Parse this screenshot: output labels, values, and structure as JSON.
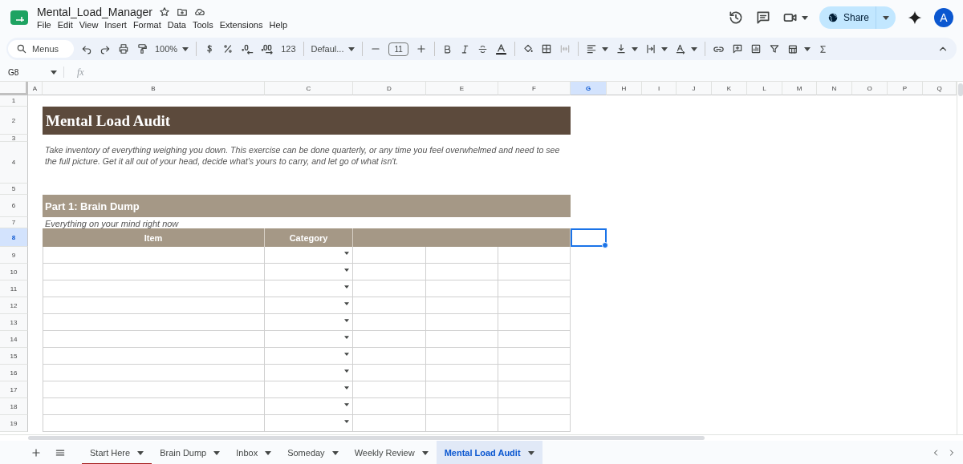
{
  "app": {
    "doc_title": "Mental_Load_Manager",
    "menu": [
      "File",
      "Edit",
      "View",
      "Insert",
      "Format",
      "Data",
      "Tools",
      "Extensions",
      "Help"
    ],
    "share_label": "Share",
    "avatar_letter": "A"
  },
  "toolbar": {
    "search_placeholder": "Menus",
    "zoom": "100%",
    "number_format": "123",
    "font": "Defaul...",
    "font_size": "11"
  },
  "formula_bar": {
    "name_box": "G8",
    "fx": "fx"
  },
  "columns": [
    {
      "label": "A",
      "selected": false
    },
    {
      "label": "B",
      "selected": false
    },
    {
      "label": "C",
      "selected": false
    },
    {
      "label": "D",
      "selected": false
    },
    {
      "label": "E",
      "selected": false
    },
    {
      "label": "F",
      "selected": false
    },
    {
      "label": "G",
      "selected": true
    },
    {
      "label": "H",
      "selected": false
    },
    {
      "label": "I",
      "selected": false
    },
    {
      "label": "J",
      "selected": false
    },
    {
      "label": "K",
      "selected": false
    },
    {
      "label": "L",
      "selected": false
    },
    {
      "label": "M",
      "selected": false
    },
    {
      "label": "N",
      "selected": false
    },
    {
      "label": "O",
      "selected": false
    },
    {
      "label": "P",
      "selected": false
    },
    {
      "label": "Q",
      "selected": false
    }
  ],
  "rows": [
    {
      "label": "1",
      "selected": false
    },
    {
      "label": "2",
      "selected": false
    },
    {
      "label": "3",
      "selected": false
    },
    {
      "label": "4",
      "selected": false
    },
    {
      "label": "5",
      "selected": false
    },
    {
      "label": "6",
      "selected": false
    },
    {
      "label": "7",
      "selected": false
    },
    {
      "label": "8",
      "selected": true
    },
    {
      "label": "9",
      "selected": false
    },
    {
      "label": "10",
      "selected": false
    },
    {
      "label": "11",
      "selected": false
    },
    {
      "label": "12",
      "selected": false
    },
    {
      "label": "13",
      "selected": false
    },
    {
      "label": "14",
      "selected": false
    },
    {
      "label": "15",
      "selected": false
    },
    {
      "label": "16",
      "selected": false
    },
    {
      "label": "17",
      "selected": false
    },
    {
      "label": "18",
      "selected": false
    },
    {
      "label": "19",
      "selected": false
    }
  ],
  "sheet": {
    "title": "Mental Load Audit",
    "intro": "Take inventory of everything weighing you down. This exercise can be done quarterly, or any time you feel overwhelmed and need to see the full picture. Get it all out of your head, decide what's yours to carry, and let go of what isn't.",
    "section": "Part 1: Brain Dump",
    "subtitle": "Everything on your mind right now",
    "table_headers": [
      "Item",
      "Category"
    ]
  },
  "sheet_tabs": [
    {
      "label": "Start Here",
      "selected": false,
      "color": "#a61c1c"
    },
    {
      "label": "Brain Dump",
      "selected": false
    },
    {
      "label": "Inbox",
      "selected": false
    },
    {
      "label": "Someday",
      "selected": false
    },
    {
      "label": "Weekly Review",
      "selected": false
    },
    {
      "label": "Mental Load Audit",
      "selected": true
    }
  ]
}
